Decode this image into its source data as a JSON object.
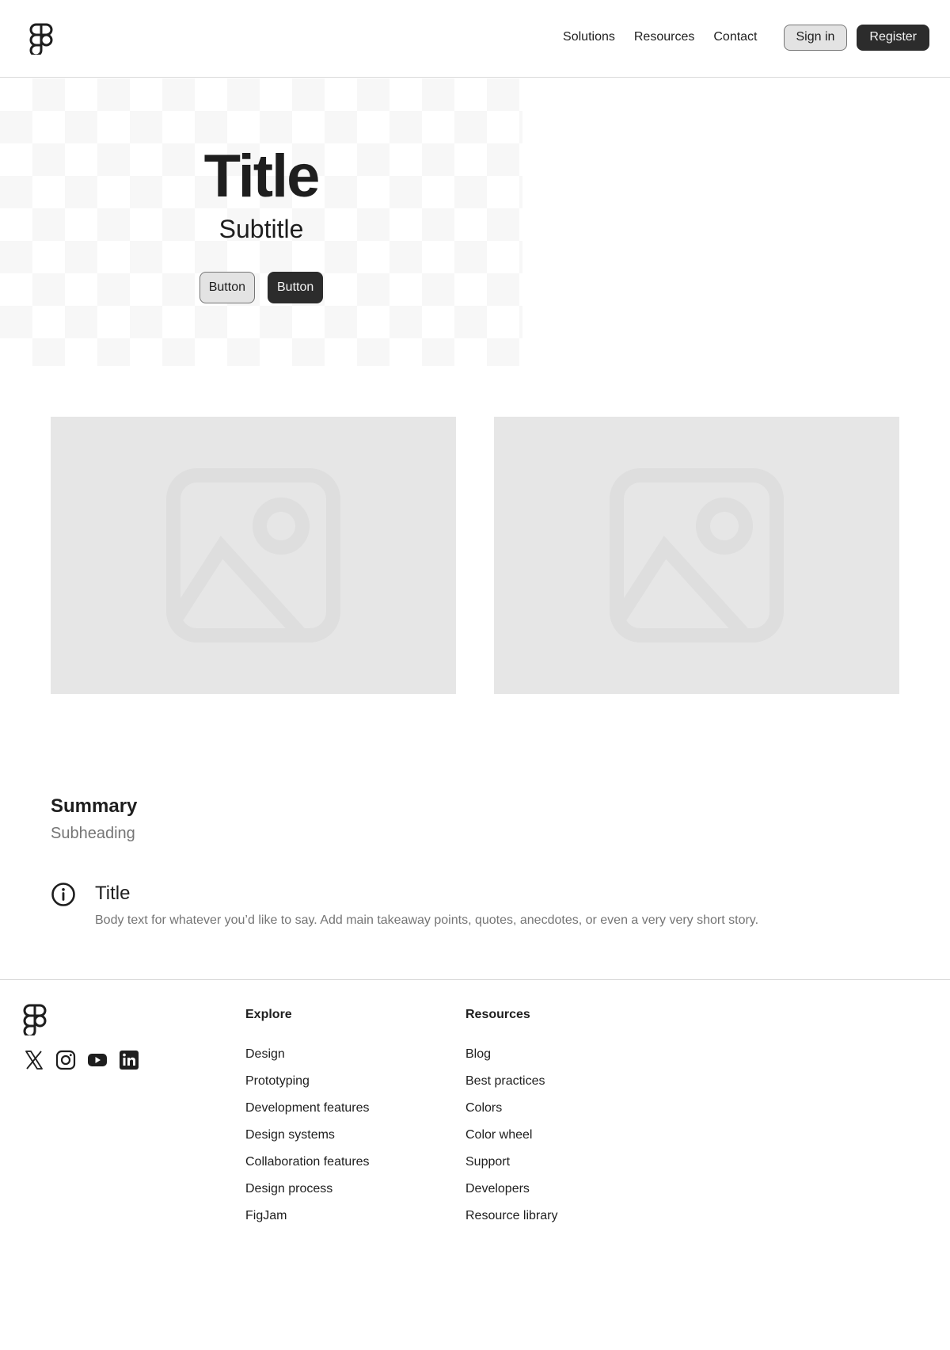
{
  "header": {
    "nav": [
      "Solutions",
      "Resources",
      "Contact"
    ],
    "sign_in": "Sign in",
    "register": "Register"
  },
  "hero": {
    "title": "Title",
    "subtitle": "Subtitle",
    "button_secondary": "Button",
    "button_primary": "Button"
  },
  "images": [
    "image-icon",
    "image-icon"
  ],
  "summary": {
    "title": "Summary",
    "subheading": "Subheading"
  },
  "info": {
    "icon": "info-icon",
    "title": "Title",
    "body": "Body text for whatever you’d like to say. Add main takeaway points, quotes, anecdotes, or even a very very short story."
  },
  "footer": {
    "socials": [
      "x-icon",
      "instagram-icon",
      "youtube-icon",
      "linkedin-icon"
    ],
    "explore": {
      "title": "Explore",
      "items": [
        "Design",
        "Prototyping",
        "Development features",
        "Design systems",
        "Collaboration features",
        "Design process",
        "FigJam"
      ]
    },
    "resources": {
      "title": "Resources",
      "items": [
        "Blog",
        "Best practices",
        "Colors",
        "Color wheel",
        "Support",
        "Developers",
        "Resource library"
      ]
    }
  },
  "colors": {
    "primary": "#2c2c2c",
    "secondary": "#e3e3e3",
    "muted_text": "#757575",
    "placeholder": "#e6e6e6"
  }
}
